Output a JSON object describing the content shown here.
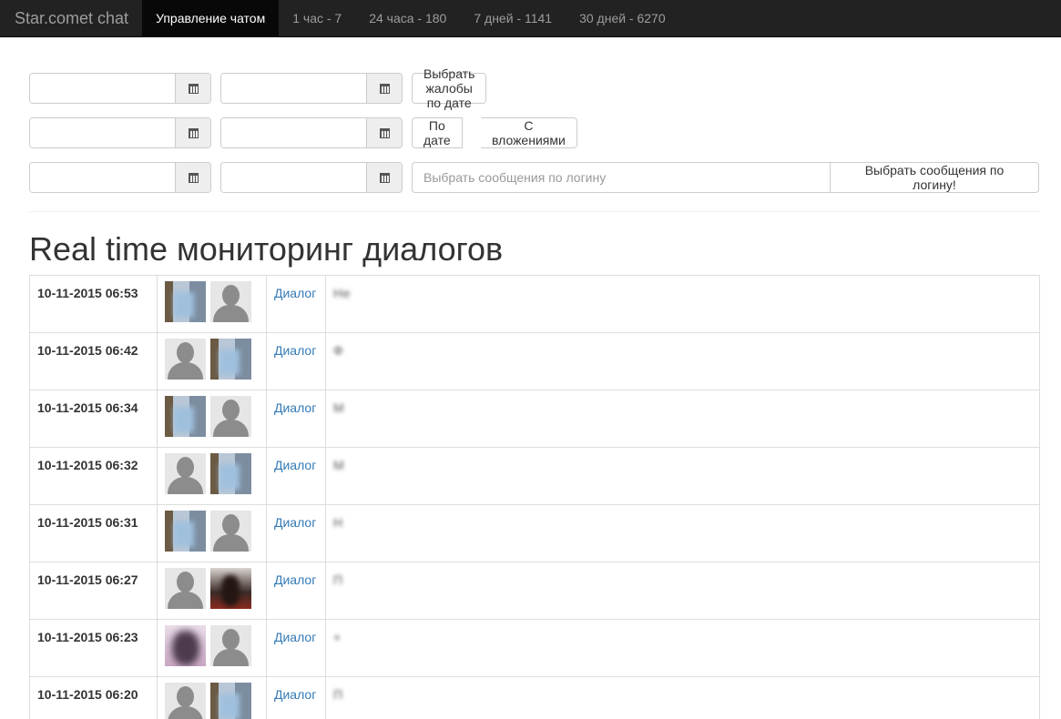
{
  "navbar": {
    "brand": "Star.comet chat",
    "items": [
      {
        "label": "Управление чатом",
        "active": true
      },
      {
        "label": "1 час - 7",
        "active": false
      },
      {
        "label": "24 часа - 180",
        "active": false
      },
      {
        "label": "7 дней - 1141",
        "active": false
      },
      {
        "label": "30 дней - 6270",
        "active": false
      }
    ]
  },
  "filters": {
    "complaints_button": "Выбрать жалобы по дате",
    "by_date_button": "По дате",
    "with_attachments_button": "С вложениями",
    "login_placeholder": "Выбрать сообщения по логину",
    "login_button": "Выбрать сообщения по логину!"
  },
  "monitor": {
    "title": "Real time мониторинг диалогов",
    "dialog_link": "Диалог",
    "rows": [
      {
        "time": "10-11-2015 06:53",
        "avatars": [
          "photo-a",
          "default"
        ],
        "message": "Не"
      },
      {
        "time": "10-11-2015 06:42",
        "avatars": [
          "default",
          "photo-a"
        ],
        "message": "Ф"
      },
      {
        "time": "10-11-2015 06:34",
        "avatars": [
          "photo-a",
          "default"
        ],
        "message": "М"
      },
      {
        "time": "10-11-2015 06:32",
        "avatars": [
          "default",
          "photo-a"
        ],
        "message": "М"
      },
      {
        "time": "10-11-2015 06:31",
        "avatars": [
          "photo-a",
          "default"
        ],
        "message": "Н"
      },
      {
        "time": "10-11-2015 06:27",
        "avatars": [
          "default",
          "photo-b"
        ],
        "message": "П"
      },
      {
        "time": "10-11-2015 06:23",
        "avatars": [
          "photo-c",
          "default"
        ],
        "message": "+"
      },
      {
        "time": "10-11-2015 06:20",
        "avatars": [
          "default",
          "photo-a"
        ],
        "message": "П"
      }
    ]
  }
}
